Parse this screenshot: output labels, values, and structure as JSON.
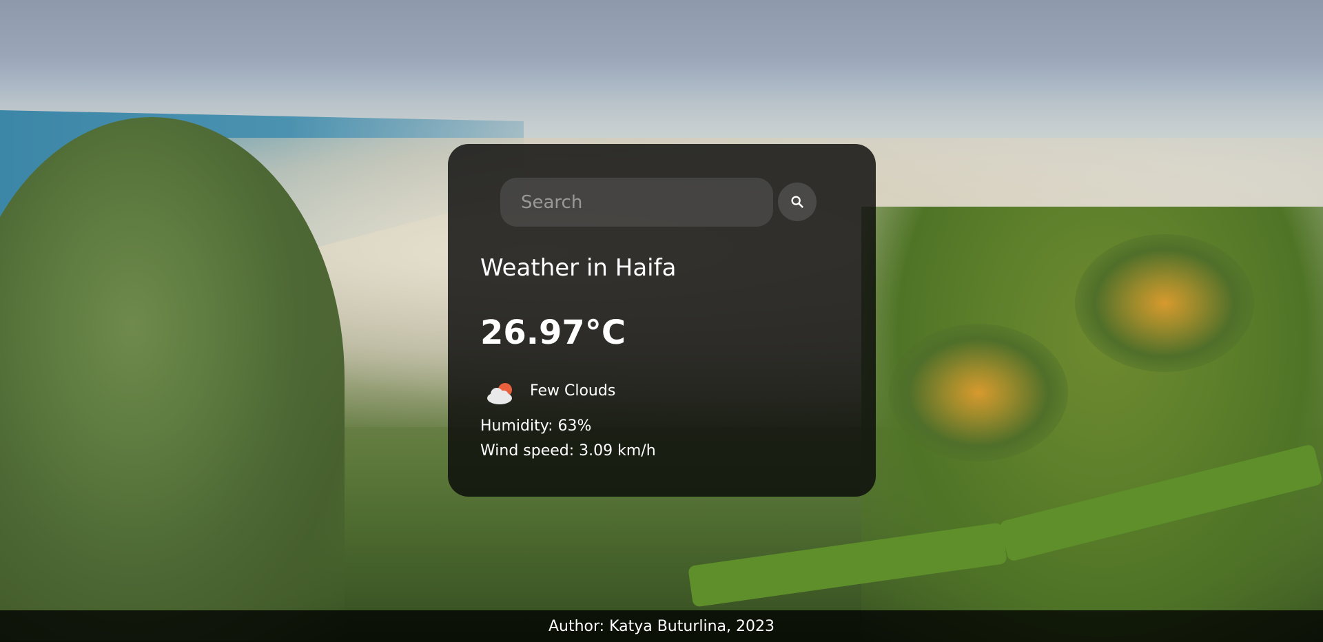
{
  "search": {
    "placeholder": "Search",
    "value": "",
    "button_icon": "search-icon"
  },
  "weather": {
    "title": "Weather in Haifa",
    "temperature": "26.97°C",
    "condition_icon": "few-clouds-icon",
    "description": "Few Clouds",
    "humidity": "Humidity: 63%",
    "wind": "Wind speed: 3.09 km/h"
  },
  "footer": {
    "text": "Author: Katya Buturlina, 2023"
  },
  "colors": {
    "card_background": "#0a0a0a",
    "text": "#ffffff",
    "cloud": "#e9e9e9",
    "sun": "#e8603c"
  }
}
